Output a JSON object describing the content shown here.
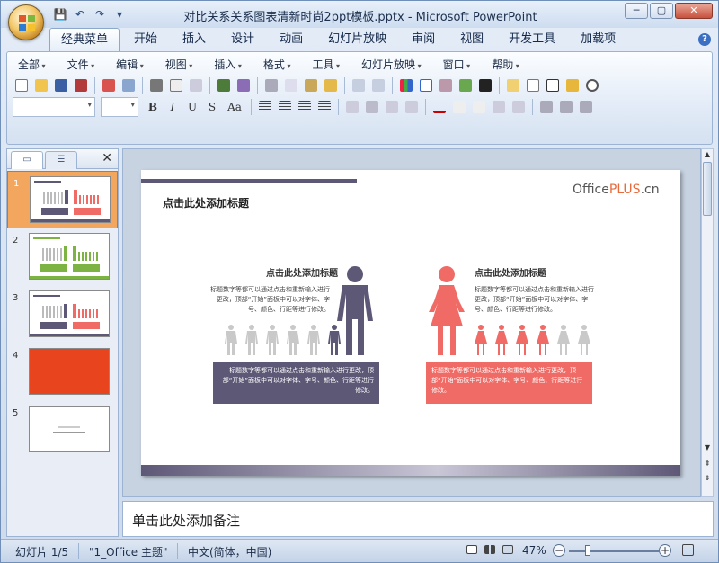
{
  "window": {
    "title": "对比关系关系图表清新时尚2ppt模板.pptx - Microsoft PowerPoint",
    "minimize": "─",
    "maximize": "▢",
    "close": "✕"
  },
  "qat": {
    "save": "💾",
    "undo": "↶",
    "redo": "↷",
    "more": "▾"
  },
  "tabs": [
    "经典菜单",
    "开始",
    "插入",
    "设计",
    "动画",
    "幻灯片放映",
    "审阅",
    "视图",
    "开发工具",
    "加载项"
  ],
  "help": "?",
  "menus": [
    "全部",
    "文件",
    "编辑",
    "视图",
    "插入",
    "格式",
    "工具",
    "幻灯片放映",
    "窗口",
    "帮助"
  ],
  "format_buttons": [
    "B",
    "I",
    "U",
    "S",
    "Aa"
  ],
  "slides_pane": {
    "tab_slides": "▭",
    "tab_outline": "☰",
    "close": "✕",
    "items": [
      {
        "num": "1",
        "variant": "purple-pink"
      },
      {
        "num": "2",
        "variant": "green"
      },
      {
        "num": "3",
        "variant": "purple-pink"
      },
      {
        "num": "4",
        "variant": "orange"
      },
      {
        "num": "5",
        "variant": "blank"
      }
    ]
  },
  "slide": {
    "title": "点击此处添加标题",
    "logo_a": "Office",
    "logo_b": "PLUS",
    "logo_c": ".cn",
    "left": {
      "subtitle": "点击此处添加标题",
      "body": "标题数字等都可以通过点击和重新输入进行更改，顶部“开始”面板中可以对字体、字号、颜色、行距等进行修改。",
      "box": "标题数字等都可以通过点击和重新输入进行更改，顶部“开始”面板中可以对字体、字号、颜色、行距等进行修改。",
      "color": "#5e5877",
      "highlight_count": 1,
      "small_count": 6
    },
    "right": {
      "subtitle": "点击此处添加标题",
      "body": "标题数字等都可以通过点击和重新输入进行更改，顶部“开始”面板中可以对字体、字号、颜色、行距等进行修改。",
      "box": "标题数字等都可以通过点击和重新输入进行更改，顶部“开始”面板中可以对字体、字号、颜色、行距等进行修改。",
      "color": "#f06b66",
      "highlight_count": 4,
      "small_count": 6
    }
  },
  "notes": {
    "placeholder": "单击此处添加备注"
  },
  "status": {
    "slide": "幻灯片 1/5",
    "theme": "\"1_Office 主题\"",
    "lang": "中文(简体，中国)",
    "zoom": "47%",
    "zoom_out": "−",
    "zoom_in": "+"
  }
}
